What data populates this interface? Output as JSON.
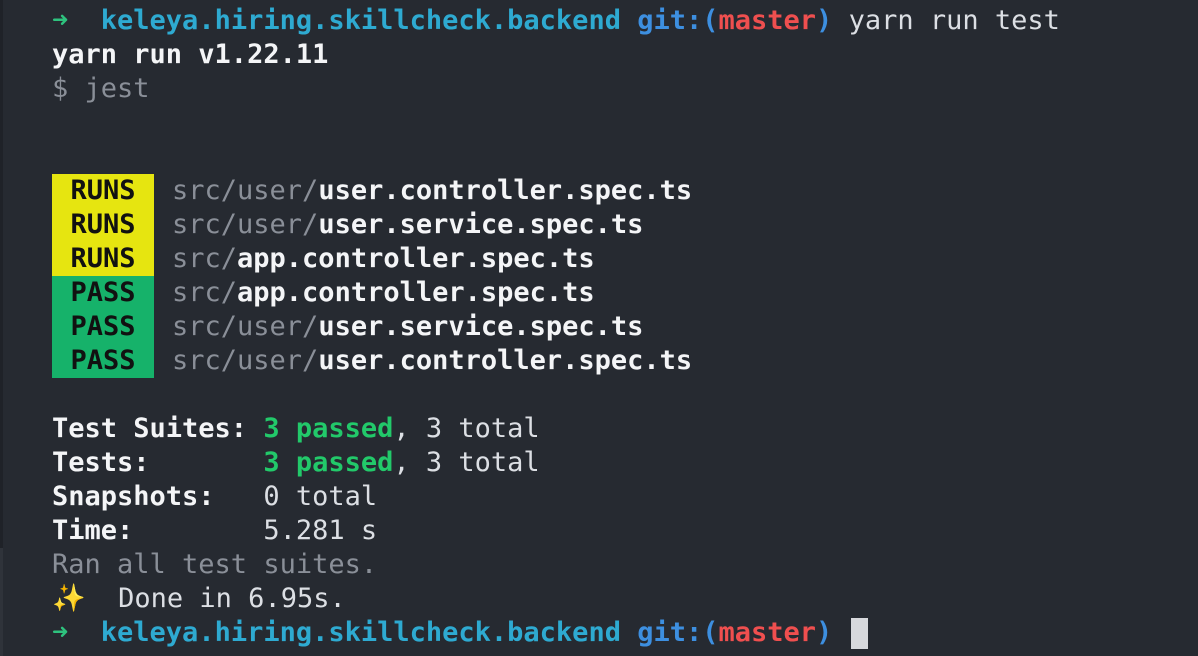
{
  "prompt": {
    "arrow": "➜",
    "directory": "keleya.hiring.skillcheck.backend",
    "git_prefix": "git:(",
    "branch": "master",
    "git_suffix": ")",
    "command": "yarn run test"
  },
  "yarn_header": "yarn run v1.22.11",
  "jest_command": "$ jest",
  "test_lines": [
    {
      "status": "RUNS",
      "path_prefix": "src/user/",
      "file": "user.controller.spec.ts"
    },
    {
      "status": "RUNS",
      "path_prefix": "src/user/",
      "file": "user.service.spec.ts"
    },
    {
      "status": "RUNS",
      "path_prefix": "src/",
      "file": "app.controller.spec.ts"
    },
    {
      "status": "PASS",
      "path_prefix": "src/",
      "file": "app.controller.spec.ts"
    },
    {
      "status": "PASS",
      "path_prefix": "src/user/",
      "file": "user.service.spec.ts"
    },
    {
      "status": "PASS",
      "path_prefix": "src/user/",
      "file": "user.controller.spec.ts"
    }
  ],
  "summary": {
    "suites_label": "Test Suites:",
    "suites_passed": "3 passed",
    "suites_total": ", 3 total",
    "tests_label": "Tests:",
    "tests_passed": "3 passed",
    "tests_total": ", 3 total",
    "snapshots_label": "Snapshots:",
    "snapshots_value": "0 total",
    "time_label": "Time:",
    "time_value": "5.281 s",
    "ran_all": "Ran all test suites."
  },
  "done": {
    "sparkle": "✨",
    "text": "Done in 6.95s."
  },
  "colors": {
    "background": "#262a31",
    "runs_badge": "#e6e510",
    "pass_badge": "#16b26a",
    "passed_text": "#22c96a",
    "directory": "#2eaad1",
    "branch": "#ef4f4f"
  }
}
